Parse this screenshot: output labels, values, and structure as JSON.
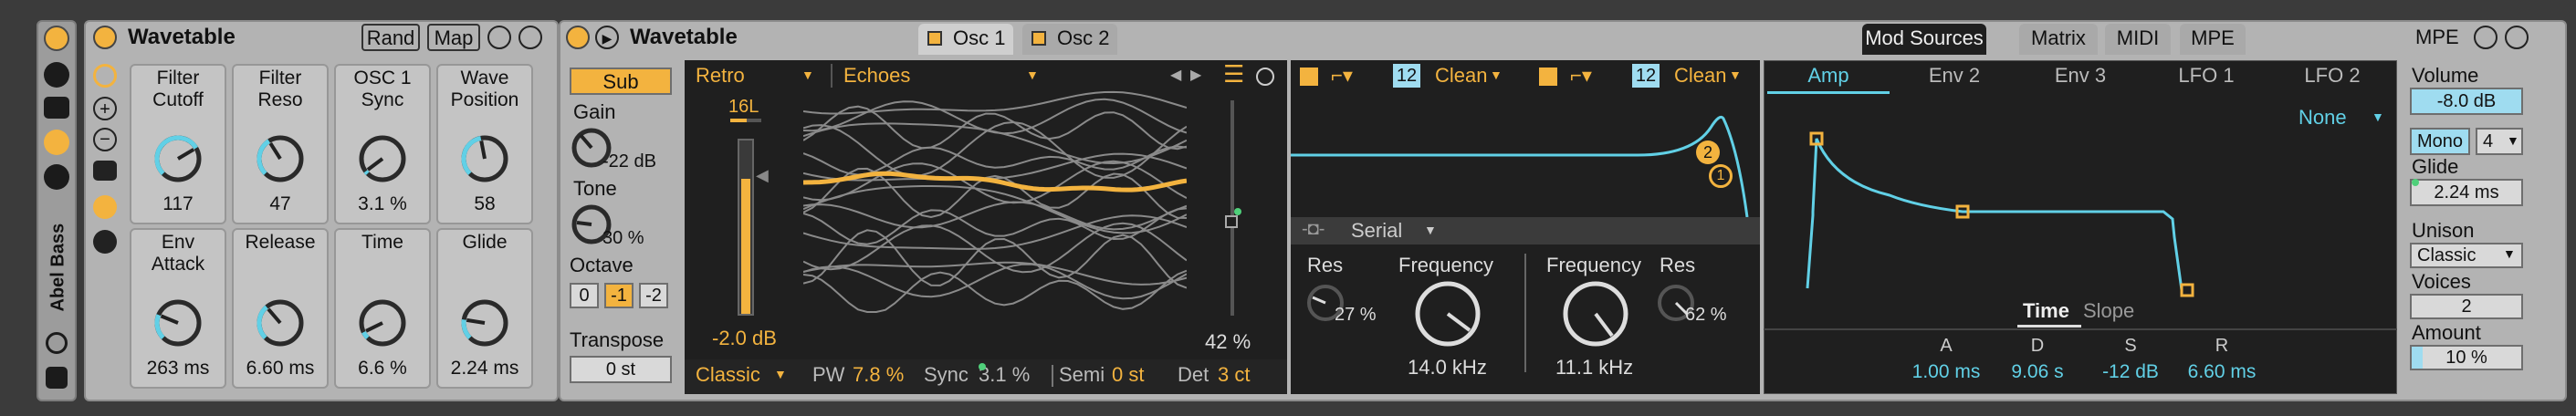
{
  "colors": {
    "accent_orange": "#f3b33f",
    "accent_cyan": "#61d0e6",
    "panel_grey": "#b3b3b3",
    "dark_bg": "#1f1f1f"
  },
  "rack": {
    "title": "Wavetable",
    "rand_label": "Rand",
    "map_label": "Map",
    "track_name": "Abel Bass",
    "macros": [
      {
        "label": "Filter\nCutoff",
        "value": "117",
        "level": 0.72
      },
      {
        "label": "Filter\nReso",
        "value": "47",
        "level": 0.38
      },
      {
        "label": "OSC 1\nSync",
        "value": "3.1 %",
        "level": 0.03
      },
      {
        "label": "Wave\nPosition",
        "value": "58",
        "level": 0.46
      },
      {
        "label": "Env\nAttack",
        "value": "263 ms",
        "level": 0.25
      },
      {
        "label": "Release",
        "value": "6.60 ms",
        "level": 0.35
      },
      {
        "label": "Time",
        "value": "6.6 %",
        "level": 0.07
      },
      {
        "label": "Glide",
        "value": "2.24 ms",
        "level": 0.2
      }
    ]
  },
  "device": {
    "title": "Wavetable",
    "tabs": [
      {
        "label": "Osc 1"
      },
      {
        "label": "Osc 2"
      }
    ],
    "right_tabs": [
      {
        "label": "Mod Sources"
      },
      {
        "label": "Matrix"
      },
      {
        "label": "MIDI"
      },
      {
        "label": "MPE"
      }
    ],
    "right_label": "MPE"
  },
  "sub": {
    "label": "Sub",
    "gain_label": "Gain",
    "gain_value": "-22 dB",
    "tone_label": "Tone",
    "tone_value": "30 %",
    "octave_label": "Octave",
    "octave_options": [
      "0",
      "-1",
      "-2"
    ],
    "octave_selected": "-1",
    "transpose_label": "Transpose",
    "transpose_value": "0 st"
  },
  "osc": {
    "category": "Retro",
    "wavetable": "Echoes",
    "unison_count": "16L",
    "gain_value": "-2.0 dB",
    "position_value": "42 %",
    "mode": "Classic",
    "pw_label": "PW",
    "pw_value": "7.8 %",
    "sync_label": "Sync",
    "sync_value": "3.1 %",
    "semi_label": "Semi",
    "semi_value": "0 st",
    "det_label": "Det",
    "det_value": "3 ct"
  },
  "filters": {
    "f1_slope": "12",
    "f1_circuit": "Clean",
    "f2_slope": "12",
    "f2_circuit": "Clean",
    "routing": "Serial",
    "f1_res_label": "Res",
    "f1_res_value": "27 %",
    "f1_freq_label": "Frequency",
    "f1_freq_value": "14.0 kHz",
    "f2_freq_label": "Frequency",
    "f2_freq_value": "11.1 kHz",
    "f2_res_label": "Res",
    "f2_res_value": "62 %",
    "badge_2": "2",
    "badge_1": "1"
  },
  "mod": {
    "tabs": [
      {
        "label": "Amp"
      },
      {
        "label": "Env 2"
      },
      {
        "label": "Env 3"
      },
      {
        "label": "LFO 1"
      },
      {
        "label": "LFO 2"
      }
    ],
    "dest": "None",
    "time_label": "Time",
    "slope_label": "Slope",
    "adsr": [
      {
        "label": "A",
        "value": "1.00 ms"
      },
      {
        "label": "D",
        "value": "9.06 s"
      },
      {
        "label": "S",
        "value": "-12 dB"
      },
      {
        "label": "R",
        "value": "6.60 ms"
      }
    ]
  },
  "global": {
    "volume_label": "Volume",
    "volume_value": "-8.0 dB",
    "mono_label": "Mono",
    "voices_poly": "4",
    "glide_label": "Glide",
    "glide_value": "2.24 ms",
    "unison_label": "Unison",
    "unison_mode": "Classic",
    "voices_label": "Voices",
    "voices_value": "2",
    "amount_label": "Amount",
    "amount_value": "10 %"
  }
}
